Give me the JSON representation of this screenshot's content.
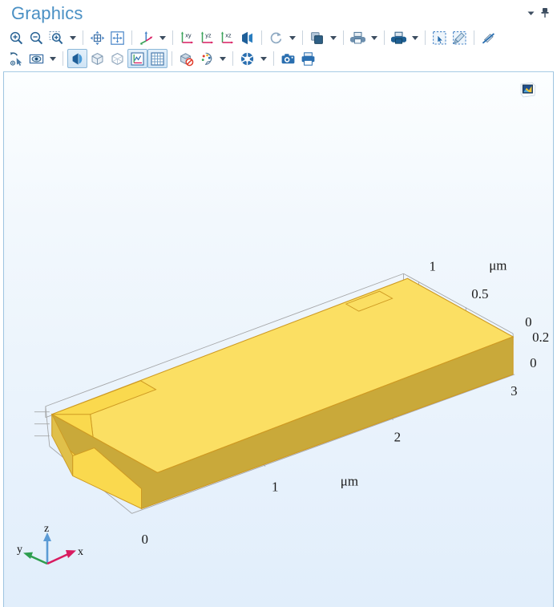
{
  "window": {
    "title": "Graphics",
    "menu_caret_icon": "chevron-down-icon",
    "pin_icon": "pin-icon"
  },
  "toolbar": {
    "row1": [
      {
        "name": "zoom-in-button",
        "icon": "zoom-in-icon",
        "label": "Zoom In",
        "type": "button"
      },
      {
        "name": "zoom-out-button",
        "icon": "zoom-out-icon",
        "label": "Zoom Out",
        "type": "button"
      },
      {
        "name": "zoom-box-button",
        "icon": "zoom-box-icon",
        "label": "Zoom Box",
        "type": "button"
      },
      {
        "name": "zoom-box-dropdown",
        "icon": "chevron-down-icon",
        "label": "Zoom Options",
        "type": "dropdown"
      },
      {
        "name": "separator",
        "type": "separator"
      },
      {
        "name": "zoom-extents-button",
        "icon": "zoom-extents-icon",
        "label": "Zoom Extents",
        "type": "button"
      },
      {
        "name": "zoom-to-selection-button",
        "icon": "zoom-to-selection-icon",
        "label": "Zoom to Selection",
        "type": "button"
      },
      {
        "name": "separator",
        "type": "separator"
      },
      {
        "name": "go-to-default-view-button",
        "icon": "default-view-axes-icon",
        "label": "Go to Default 3D View",
        "type": "button"
      },
      {
        "name": "view-dropdown",
        "icon": "chevron-down-icon",
        "label": "View Options",
        "type": "dropdown"
      },
      {
        "name": "separator",
        "type": "separator"
      },
      {
        "name": "go-to-xy-view-button",
        "icon": "xy-view-icon",
        "label": "Go to XY View",
        "type": "button"
      },
      {
        "name": "go-to-yz-view-button",
        "icon": "yz-view-icon",
        "label": "Go to YZ View",
        "type": "button"
      },
      {
        "name": "go-to-xz-view-button",
        "icon": "xz-view-icon",
        "label": "Go to XZ View",
        "type": "button"
      },
      {
        "name": "toggle-orthographic-button",
        "icon": "camera-projection-icon",
        "label": "Orthographic Projection",
        "type": "button"
      },
      {
        "name": "separator",
        "type": "separator"
      },
      {
        "name": "reset-rotation-button",
        "icon": "rotate-icon",
        "label": "Reset Rotation",
        "type": "button"
      },
      {
        "name": "rotation-dropdown",
        "icon": "chevron-down-icon",
        "label": "Rotation Options",
        "type": "dropdown"
      },
      {
        "name": "separator",
        "type": "separator"
      },
      {
        "name": "transparency-button",
        "icon": "transparency-icon",
        "label": "Transparency",
        "type": "button"
      },
      {
        "name": "transparency-dropdown",
        "icon": "chevron-down-icon",
        "label": "Transparency Options",
        "type": "dropdown"
      },
      {
        "name": "separator",
        "type": "separator"
      },
      {
        "name": "print-preview-button",
        "icon": "print-preview-icon",
        "label": "Print Preview",
        "type": "button"
      },
      {
        "name": "print-preview-dropdown",
        "icon": "chevron-down-icon",
        "label": "Print Preview Options",
        "type": "dropdown"
      },
      {
        "name": "separator",
        "type": "separator"
      },
      {
        "name": "scene-light-button",
        "icon": "scene-light-icon",
        "label": "Scene Light",
        "type": "button"
      },
      {
        "name": "scene-light-dropdown",
        "icon": "chevron-down-icon",
        "label": "Scene Light Options",
        "type": "dropdown"
      },
      {
        "name": "separator",
        "type": "separator"
      },
      {
        "name": "select-box-button",
        "icon": "select-box-icon",
        "label": "Select Box",
        "type": "button"
      },
      {
        "name": "deselect-box-button",
        "icon": "deselect-box-icon",
        "label": "Deselect Box",
        "type": "button"
      },
      {
        "name": "separator",
        "type": "separator"
      },
      {
        "name": "clear-selection-button",
        "icon": "clear-selection-icon",
        "label": "Clear Selection",
        "type": "button"
      }
    ],
    "row2": [
      {
        "name": "zoom-to-selection-alt-button",
        "icon": "select-tool-icon",
        "label": "Select Tool",
        "type": "button"
      },
      {
        "name": "hide-geometry-button",
        "icon": "eye-box-icon",
        "label": "Show Hidden Entities",
        "type": "button"
      },
      {
        "name": "hide-geometry-dropdown",
        "icon": "chevron-down-icon",
        "label": "Hide Options",
        "type": "dropdown"
      },
      {
        "name": "separator",
        "type": "separator"
      },
      {
        "name": "toggle-lighting-button",
        "icon": "half-sphere-light-icon",
        "label": "Lighting",
        "type": "toggle",
        "active": true
      },
      {
        "name": "wireframe-rendering-button",
        "icon": "solid-cube-icon",
        "label": "Wireframe Rendering",
        "type": "toggle",
        "active": false
      },
      {
        "name": "transparent-cube-button",
        "icon": "transparent-cube-icon",
        "label": "Transparency Render",
        "type": "toggle",
        "active": false
      },
      {
        "name": "show-axes-button",
        "icon": "axis-plot-icon",
        "label": "Show Axis",
        "type": "toggle",
        "active": true
      },
      {
        "name": "show-grid-button",
        "icon": "grid-icon",
        "label": "Show Grid",
        "type": "toggle",
        "active": true
      },
      {
        "name": "separator",
        "type": "separator"
      },
      {
        "name": "hide-geometric-entities-button",
        "icon": "cube-no-entry-icon",
        "label": "Hide Geometric Entities",
        "type": "button"
      },
      {
        "name": "color-legend-button",
        "icon": "color-palette-icon",
        "label": "Color Legend",
        "type": "button"
      },
      {
        "name": "color-legend-dropdown",
        "icon": "chevron-down-icon",
        "label": "Color Options",
        "type": "dropdown"
      },
      {
        "name": "separator",
        "type": "separator"
      },
      {
        "name": "image-snapshot-button",
        "icon": "aperture-icon",
        "label": "Image Snapshot",
        "type": "button"
      },
      {
        "name": "image-snapshot-dropdown",
        "icon": "chevron-down-icon",
        "label": "Snapshot Options",
        "type": "dropdown"
      },
      {
        "name": "separator",
        "type": "separator"
      },
      {
        "name": "camera-snapshot-button",
        "icon": "camera-icon",
        "label": "Camera",
        "type": "button"
      },
      {
        "name": "print-button",
        "icon": "printer-icon",
        "label": "Print",
        "type": "button"
      }
    ]
  },
  "canvas": {
    "thumbnail_icon": "image-thumbnail-icon",
    "background_top_color": "#fbfdff",
    "background_bottom_color": "#e3f0fb",
    "geometry": {
      "name": "waveguide-slab",
      "top_face_color": "#F9D94F",
      "front_face_color": "#C9A93A",
      "side_face_color": "#FBDE63",
      "edge_color": "#CE9A22",
      "bounding_box_edge_color": "#9a9a9a"
    },
    "axes": {
      "x_axis": {
        "unit_label": "μm",
        "ticks": [
          "0",
          "1",
          "2",
          "3"
        ]
      },
      "y_axis": {
        "unit_label": "μm",
        "ticks": [
          "0",
          "0.5",
          "1"
        ]
      },
      "z_axis": {
        "ticks": [
          "0",
          "0.2"
        ]
      }
    },
    "triad": {
      "x_label": "x",
      "y_label": "y",
      "z_label": "z",
      "x_color": "#d81b60",
      "y_color": "#2e9e4f",
      "z_color": "#5b9bd5"
    }
  }
}
